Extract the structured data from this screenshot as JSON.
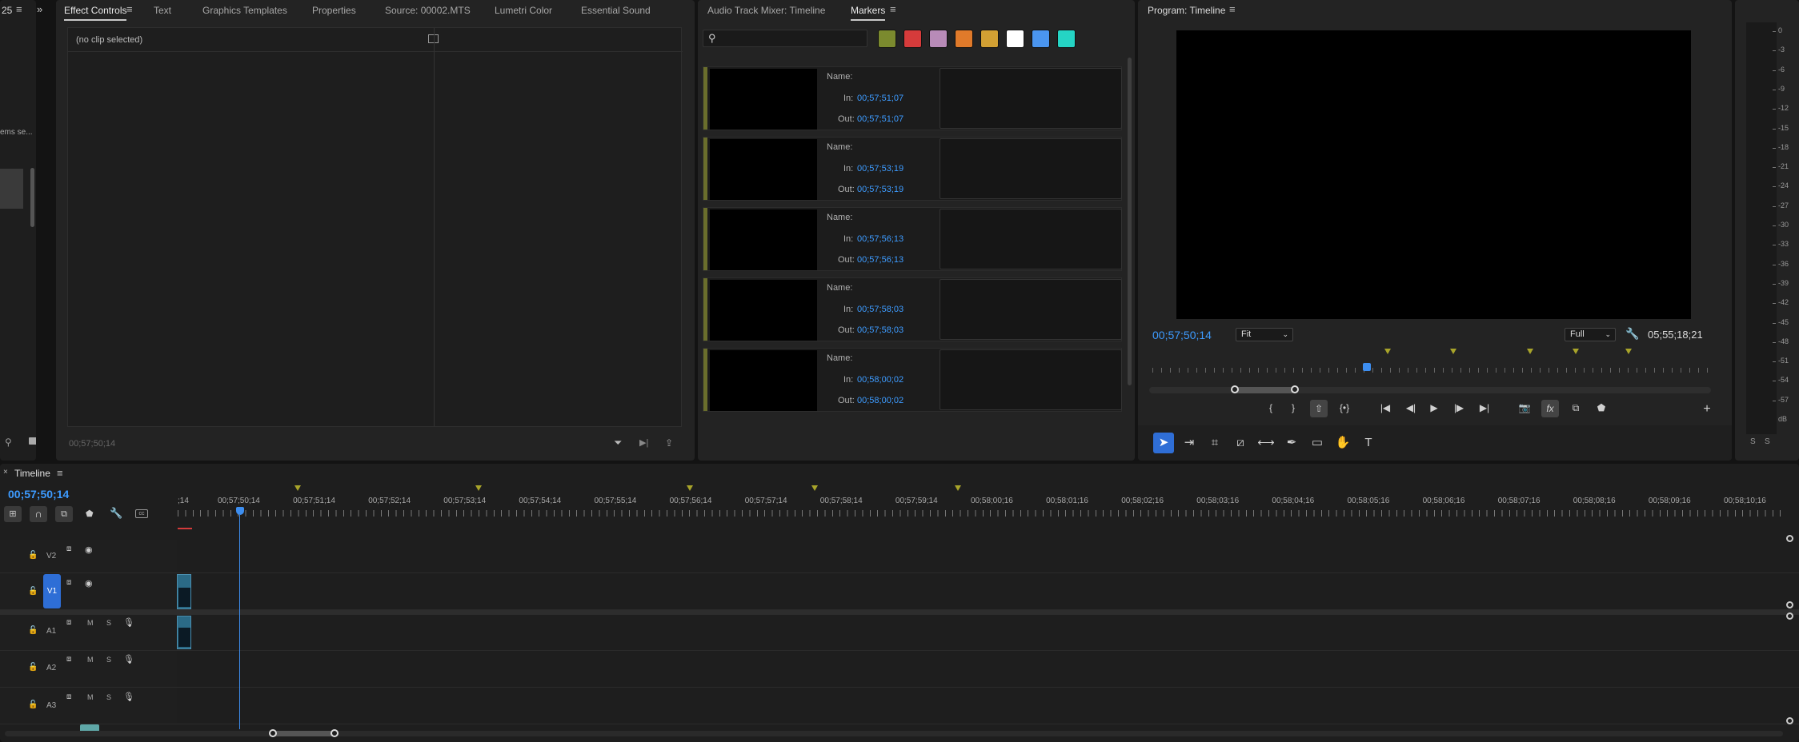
{
  "project_panel": {
    "tab_fragment": "25",
    "text_fragment": "ems se..."
  },
  "effect_controls": {
    "tabs": [
      "Effect Controls",
      "Text",
      "Graphics Templates",
      "Properties",
      "Source: 00002.MTS",
      "Lumetri Color",
      "Essential Sound"
    ],
    "no_clip": "(no clip selected)",
    "timecode": "00;57;50;14"
  },
  "markers_panel": {
    "tabs": [
      "Audio Track Mixer: Timeline",
      "Markers"
    ],
    "search_placeholder": "",
    "colors": [
      "#7b8a2e",
      "#d63b3b",
      "#b88bb8",
      "#e07a2a",
      "#d2a033",
      "#ffffff",
      "#4a95f0",
      "#25d4c4"
    ],
    "name_label": "Name:",
    "in_label": "In:",
    "out_label": "Out:",
    "markers": [
      {
        "in": "00;57;51;07",
        "out": "00;57;51;07"
      },
      {
        "in": "00;57;53;19",
        "out": "00;57;53;19"
      },
      {
        "in": "00;57;56;13",
        "out": "00;57;56;13"
      },
      {
        "in": "00;57;58;03",
        "out": "00;57;58;03"
      },
      {
        "in": "00;58;00;02",
        "out": "00;58;00;02"
      }
    ]
  },
  "program_monitor": {
    "title": "Program: Timeline",
    "timecode": "00;57;50;14",
    "fit_value": "Fit",
    "resolution": "Full",
    "duration": "05;55;18;21"
  },
  "audio_meter": {
    "labels": [
      "0",
      "-3",
      "-6",
      "-9",
      "-12",
      "-15",
      "-18",
      "-21",
      "-24",
      "-27",
      "-30",
      "-33",
      "-36",
      "-39",
      "-42",
      "-45",
      "-48",
      "-51",
      "-54",
      "-57",
      "dB"
    ],
    "solo": [
      "S",
      "S"
    ]
  },
  "timeline": {
    "title": "Timeline",
    "timecode": "00;57;50;14",
    "ruler": [
      ";14",
      "00;57;50;14",
      "00;57;51;14",
      "00;57;52;14",
      "00;57;53;14",
      "00;57;54;14",
      "00;57;55;14",
      "00;57;56;14",
      "00;57;57;14",
      "00;57;58;14",
      "00;57;59;14",
      "00;58;00;16",
      "00;58;01;16",
      "00;58;02;16",
      "00;58;03;16",
      "00;58;04;16",
      "00;58;05;16",
      "00;58;06;16",
      "00;58;07;16",
      "00;58;08;16",
      "00;58;09;16",
      "00;58;10;16"
    ],
    "tracks": {
      "video": [
        "V2",
        "V1"
      ],
      "audio": [
        "A1",
        "A2",
        "A3"
      ],
      "mute": "M",
      "solo": "S"
    }
  }
}
